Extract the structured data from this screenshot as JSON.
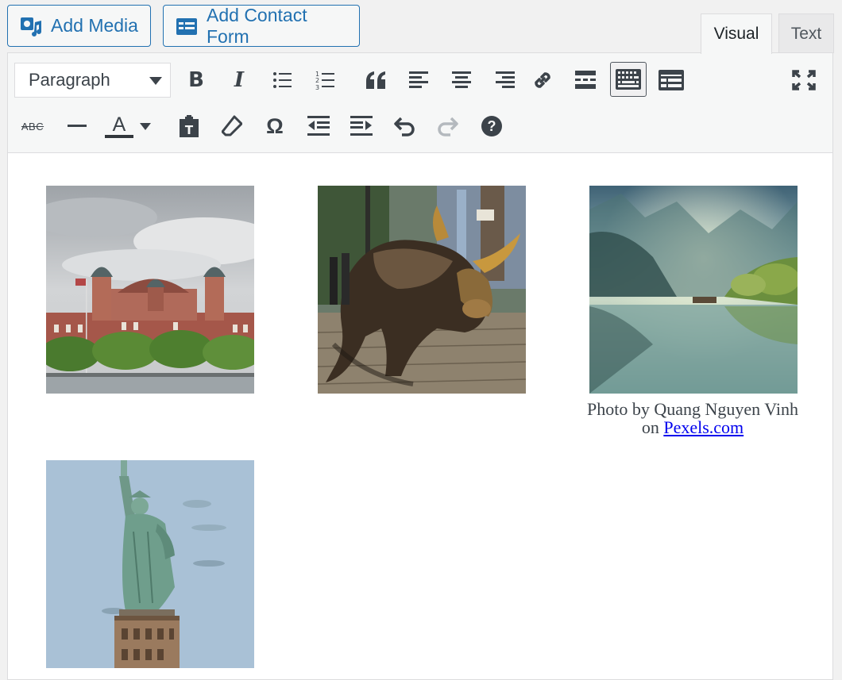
{
  "toolbar_top": {
    "add_media_label": "Add Media",
    "add_contact_form_label": "Add Contact Form"
  },
  "tabs": {
    "visual": "Visual",
    "text": "Text",
    "active": "Visual"
  },
  "editor_toolbar": {
    "format_select_value": "Paragraph",
    "row1": [
      "bold",
      "italic",
      "bulleted-list",
      "numbered-list",
      "blockquote",
      "align-left",
      "align-center",
      "align-right",
      "insert-link",
      "read-more",
      "toolbar-toggle",
      "contact-form",
      "fullscreen"
    ],
    "row2": [
      "strikethrough",
      "horizontal-line",
      "text-color",
      "paste-as-text",
      "clear-formatting",
      "special-character",
      "decrease-indent",
      "increase-indent",
      "undo",
      "redo",
      "keyboard-shortcuts"
    ],
    "bold_glyph": "B",
    "italic_glyph": "I",
    "strikethrough_glyph": "ABC",
    "text_color_glyph": "A",
    "omega_glyph": "Ω",
    "help_glyph": "?",
    "text_color_underline": "#32373c"
  },
  "content": {
    "images": [
      {
        "subject": "Ellis Island building"
      },
      {
        "subject": "Charging Bull statue"
      },
      {
        "subject": "Misty lake landscape"
      },
      {
        "subject": "Statue of Liberty"
      }
    ],
    "caption_line1": "Photo by Quang Nguyen Vinh",
    "caption_on": "on",
    "caption_link": "Pexels.com"
  },
  "colors": {
    "accent": "#2271b1",
    "icon": "#3c434a",
    "disabled_icon": "#b4b9be",
    "link": "#0000ee"
  }
}
